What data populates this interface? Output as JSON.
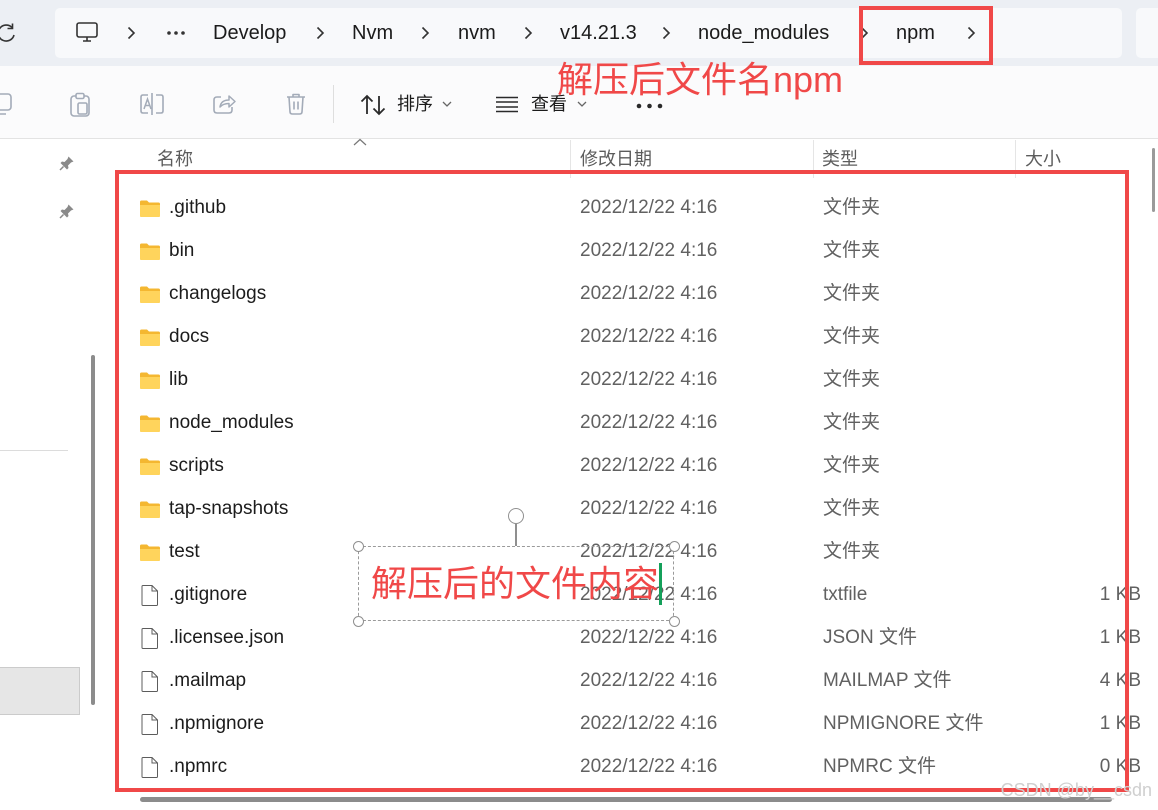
{
  "address_bar": {
    "crumbs": [
      "Develop",
      "Nvm",
      "nvm",
      "v14.21.3",
      "node_modules",
      "npm"
    ],
    "refresh_icon": "refresh-icon",
    "root_icon": "this-pc-icon",
    "overflow_icon": "more-icon",
    "separator_icon": "chevron-right-icon"
  },
  "toolbar": {
    "buttons": [
      "copy-icon",
      "paste-icon",
      "rename-icon",
      "share-icon",
      "delete-icon"
    ],
    "sort_icon": "sort-icon",
    "sort_label": "排序",
    "view_icon": "view-list-icon",
    "view_label": "查看",
    "more_icon": "more-icon"
  },
  "navigation_pane": {
    "pin_icon": "pin-icon"
  },
  "columns": {
    "name": "名称",
    "modified": "修改日期",
    "type": "类型",
    "size": "大小",
    "sort_indicator_icon": "sort-ascending-icon"
  },
  "files": [
    {
      "name": ".github",
      "modified": "2022/12/22 4:16",
      "type": "文件夹",
      "icon": "folder-icon"
    },
    {
      "name": "bin",
      "modified": "2022/12/22 4:16",
      "type": "文件夹",
      "icon": "folder-icon"
    },
    {
      "name": "changelogs",
      "modified": "2022/12/22 4:16",
      "type": "文件夹",
      "icon": "folder-icon"
    },
    {
      "name": "docs",
      "modified": "2022/12/22 4:16",
      "type": "文件夹",
      "icon": "folder-icon"
    },
    {
      "name": "lib",
      "modified": "2022/12/22 4:16",
      "type": "文件夹",
      "icon": "folder-icon"
    },
    {
      "name": "node_modules",
      "modified": "2022/12/22 4:16",
      "type": "文件夹",
      "icon": "folder-icon"
    },
    {
      "name": "scripts",
      "modified": "2022/12/22 4:16",
      "type": "文件夹",
      "icon": "folder-icon"
    },
    {
      "name": "tap-snapshots",
      "modified": "2022/12/22 4:16",
      "type": "文件夹",
      "icon": "folder-icon"
    },
    {
      "name": "test",
      "modified": "2022/12/22 4:16",
      "type": "文件夹",
      "icon": "folder-icon"
    },
    {
      "name": ".gitignore",
      "modified": "2022/12/22 4:16",
      "type": "txtfile",
      "size": "1 KB",
      "icon": "file-icon"
    },
    {
      "name": ".licensee.json",
      "modified": "2022/12/22 4:16",
      "type": "JSON 文件",
      "size": "1 KB",
      "icon": "file-icon"
    },
    {
      "name": ".mailmap",
      "modified": "2022/12/22 4:16",
      "type": "MAILMAP 文件",
      "size": "4 KB",
      "icon": "file-icon"
    },
    {
      "name": ".npmignore",
      "modified": "2022/12/22 4:16",
      "type": "NPMIGNORE 文件",
      "size": "1 KB",
      "icon": "file-icon"
    },
    {
      "name": ".npmrc",
      "modified": "2022/12/22 4:16",
      "type": "NPMRC 文件",
      "size": "0 KB",
      "icon": "file-icon"
    }
  ],
  "annotations": {
    "filename_note": "解压后文件名npm",
    "contents_note": "解压后的文件内容"
  },
  "watermark": "CSDN @by__csdn",
  "colors": {
    "annotation_red": "#f04848",
    "folder_yellow": "#ffd45c",
    "text_cursor_green": "#14a05a",
    "disabled_icon_gray": "#a3abb8"
  }
}
